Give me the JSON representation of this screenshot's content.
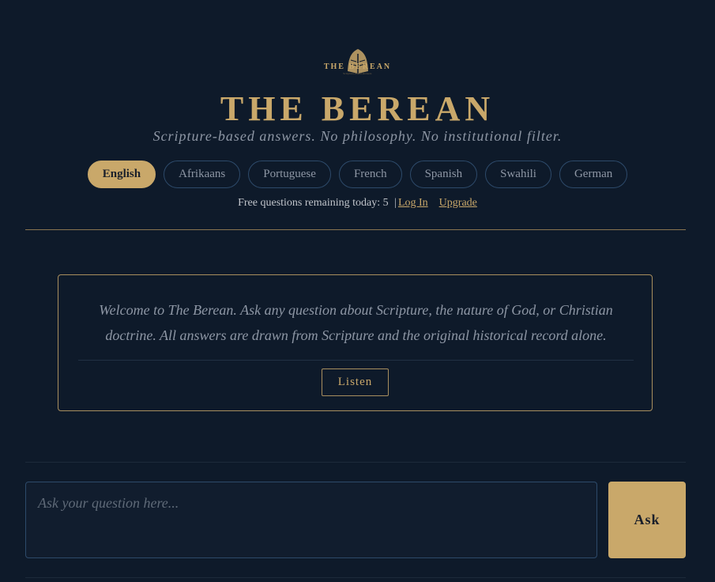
{
  "header": {
    "logo_text": "THE BEREAN",
    "logo_tagline": "Scripture-based answers",
    "title": "THE BEREAN",
    "subtitle": "Scripture-based answers. No philosophy. No institutional filter."
  },
  "languages": [
    {
      "label": "English",
      "active": true
    },
    {
      "label": "Afrikaans",
      "active": false
    },
    {
      "label": "Portuguese",
      "active": false
    },
    {
      "label": "French",
      "active": false
    },
    {
      "label": "Spanish",
      "active": false
    },
    {
      "label": "Swahili",
      "active": false
    },
    {
      "label": "German",
      "active": false
    }
  ],
  "quota": {
    "label": "Free questions remaining today:",
    "count": "5",
    "separator": "|",
    "login": "Log In",
    "upgrade": "Upgrade"
  },
  "welcome": {
    "text": "Welcome to The Berean. Ask any question about Scripture, the nature of God, or Christian doctrine. All answers are drawn from Scripture and the original historical record alone.",
    "listen_label": "Listen"
  },
  "ask_form": {
    "placeholder": "Ask your question here...",
    "value": "",
    "button_label": "Ask"
  },
  "colors": {
    "background": "#0e1a2a",
    "accent_gold": "#c9a86a",
    "muted_text": "#8d96a4",
    "border_blue": "#2d4a6a"
  }
}
